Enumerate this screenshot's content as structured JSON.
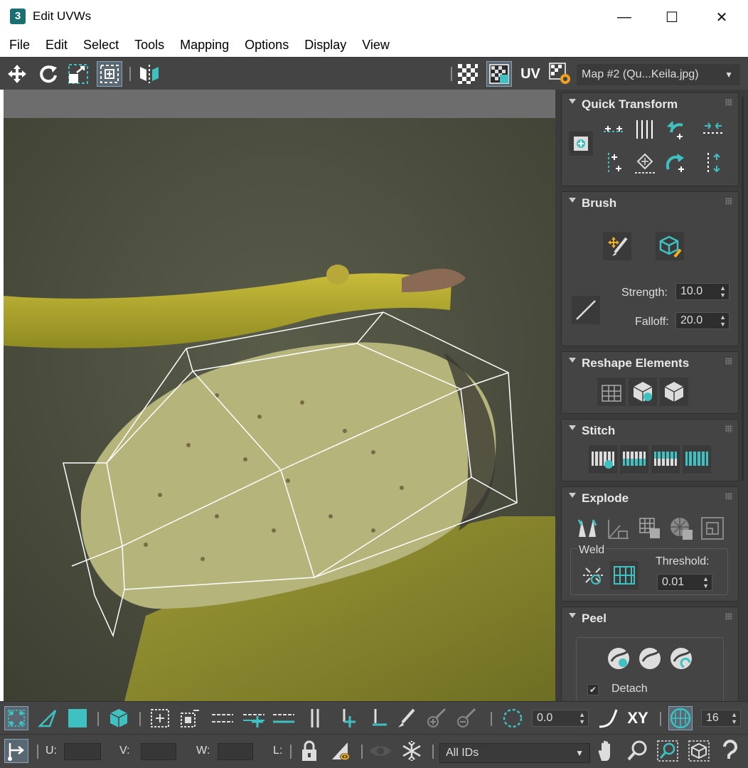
{
  "window": {
    "title": "Edit UVWs",
    "app_badge": "3",
    "minimize": "—",
    "maximize": "☐",
    "close": "✕"
  },
  "menu": [
    "File",
    "Edit",
    "Select",
    "Tools",
    "Mapping",
    "Options",
    "Display",
    "View"
  ],
  "toolbar": {
    "uv_label": "UV",
    "map_select": "Map #2 (Qu...Keila.jpg)"
  },
  "side": {
    "quick_transform": {
      "title": "Quick Transform"
    },
    "brush": {
      "title": "Brush",
      "strength_label": "Strength:",
      "strength_value": "10.0",
      "falloff_label": "Falloff:",
      "falloff_value": "20.0"
    },
    "reshape": {
      "title": "Reshape Elements"
    },
    "stitch": {
      "title": "Stitch"
    },
    "explode": {
      "title": "Explode",
      "weld_label": "Weld",
      "threshold_label": "Threshold:",
      "threshold_value": "0.01"
    },
    "peel": {
      "title": "Peel",
      "detach_label": "Detach"
    }
  },
  "bottom": {
    "rotate_value": "0.0",
    "xy_label": "XY",
    "grid_value": "16",
    "u_label": "U:",
    "v_label": "V:",
    "w_label": "W:",
    "l_label": "L:",
    "ids_select": "All IDs"
  },
  "colors": {
    "accent": "#3fc1c1",
    "panel": "#444444",
    "viewport": "#464840"
  }
}
